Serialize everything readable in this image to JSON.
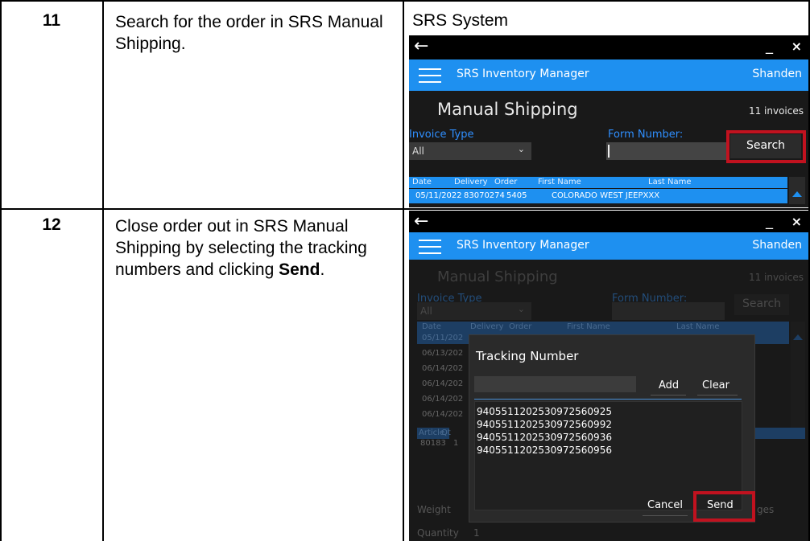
{
  "rows": [
    {
      "step": "11",
      "instruction": "Search for the order in SRS Manual Shipping.",
      "system_label": "SRS System"
    },
    {
      "step": "12",
      "instruction_pre": "Close order out in SRS Manual Shipping by selecting the tracking numbers and clicking ",
      "instruction_bold": "Send",
      "instruction_post": "."
    }
  ],
  "app": {
    "back_icon": "arrow-left-icon",
    "minimize": "_",
    "close": "×",
    "app_name": "SRS Inventory Manager",
    "user": "Shanden",
    "page_title": "Manual Shipping",
    "invoice_count": "11 invoices",
    "invoice_type_label": "Invoice Type",
    "invoice_type_value": "All",
    "form_number_label": "Form Number:",
    "search_button": "Search",
    "grid_headers": [
      "Date",
      "Delivery",
      "Order",
      "First Name",
      "Last Name"
    ],
    "first_row": {
      "date": "05/11/2022",
      "delivery": "83070274",
      "order": "5405",
      "name": "COLORADO WEST JEEPXXX"
    }
  },
  "app2": {
    "dim_dates": [
      "05/11/202",
      "06/13/202",
      "06/14/202",
      "06/14/202",
      "06/14/202",
      "06/14/202"
    ],
    "detail_headers": [
      "Article",
      "Qt"
    ],
    "detail_row": [
      "80183",
      "1"
    ],
    "weight_label": "Weight",
    "quantity_label": "Quantity",
    "quantity_value": "1",
    "ges_fragment": "ges"
  },
  "dialog": {
    "title": "Tracking Number",
    "add_button": "Add",
    "clear_button": "Clear",
    "tracking_numbers": [
      "9405511202530972560925",
      "9405511202530972560992",
      "9405511202530972560936",
      "9405511202530972560956"
    ],
    "cancel_button": "Cancel",
    "send_button": "Send"
  },
  "colors": {
    "accent": "#1e90f0",
    "highlight": "#c1121f",
    "app_background": "#191919"
  }
}
